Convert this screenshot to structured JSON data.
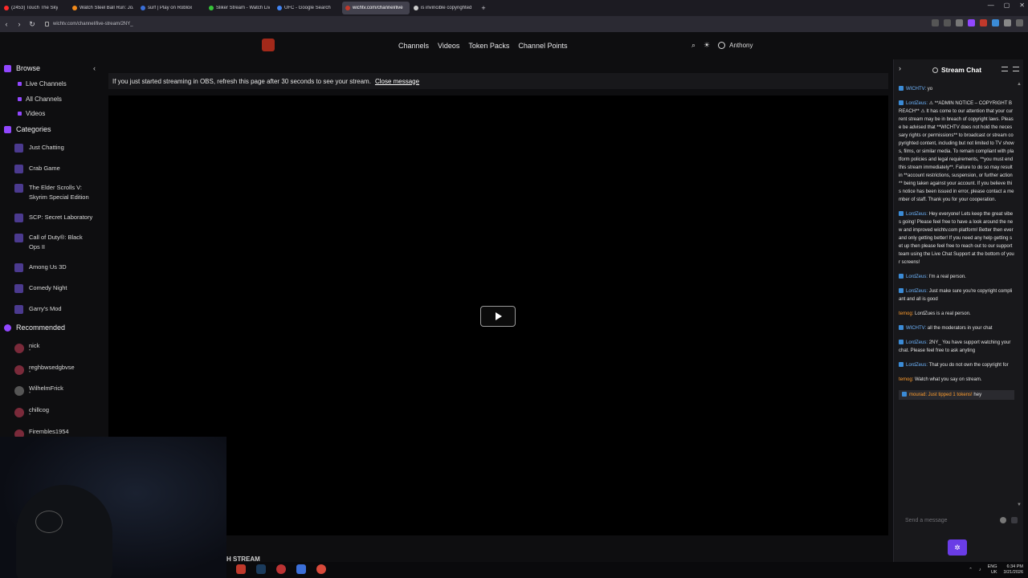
{
  "browser": {
    "tabs": [
      {
        "label": "(2453) Touch The Sky",
        "color": "#ff2a2a"
      },
      {
        "label": "Watch Steel Ball Run: JoJo",
        "color": "#f28a1a"
      },
      {
        "label": "surf | Play on Roblox",
        "color": "#3a6fd8"
      },
      {
        "label": "Sliker Stream - Watch Liv",
        "color": "#37c43a"
      },
      {
        "label": "UFC - Google Search",
        "color": "#4285f4"
      },
      {
        "label": "wichtv.com/channel/live",
        "color": "#c0392b"
      },
      {
        "label": "is invincible copyrighted",
        "color": "#cccccc"
      }
    ],
    "new_tab": "+",
    "url": "wichtv.com/channel/live-stream/2NY_"
  },
  "header": {
    "nav": [
      "Channels",
      "Videos",
      "Token Packs",
      "Channel Points"
    ],
    "user_name": "Anthony"
  },
  "sidebar": {
    "browse_title": "Browse",
    "browse_links": [
      "Live Channels",
      "All Channels",
      "Videos"
    ],
    "categories_title": "Categories",
    "categories": [
      "Just Chatting",
      "Crab Game",
      "The Elder Scrolls V: Skyrim Special Edition",
      "SCP: Secret Laboratory",
      "Call of Duty®: Black Ops II",
      "Among Us 3D",
      "Comedy Night",
      "Garry's Mod"
    ],
    "recommended_title": "Recommended",
    "recommended": [
      {
        "name": "nick",
        "sub": "•"
      },
      {
        "name": "reghbwsedgbvse",
        "sub": "•"
      },
      {
        "name": "WilhelmFrick",
        "sub": "•"
      },
      {
        "name": "chillcog",
        "sub": "•"
      },
      {
        "name": "Firembles1954",
        "sub": ""
      }
    ]
  },
  "main": {
    "notice_text": "If you just started streaming in OBS, refresh this page after 30 seconds to see your stream.",
    "close_message": "Close message",
    "below_player_text": "H STREAM"
  },
  "chat": {
    "title": "Stream Chat",
    "messages": [
      {
        "name": "WICHTV:",
        "text": "yo",
        "color": "blue"
      },
      {
        "name": "LordZeus:",
        "text": "⚠ **ADMIN NOTICE – COPYRIGHT BREACH** ⚠ It has come to our attention that your current stream may be in breach of copyright laws. Please be advised that **WICHTV does not hold the necessary rights or permissions** to broadcast or stream copyrighted content, including but not limited to TV shows, films, or similar media. To remain compliant with platform policies and legal requirements, **you must end this stream immediately**. Failure to do so may result in **account restrictions, suspension, or further action** being taken against your account. If you believe this notice has been issued in error, please contact a member of staff. Thank you for your cooperation.",
        "color": "blue"
      },
      {
        "name": "LordZeus:",
        "text": "Hey everyone! Lets keep the great vibes going! Please feel free to have a look around the new and improved wichtv.com platform! Better then ever and only getting better! If you need any help getting set up then please feel free to reach out to our support team using the Live Chat Support at the bottom of your screens!",
        "color": "blue"
      },
      {
        "name": "LordZeus:",
        "text": "I'm a real person.",
        "color": "blue"
      },
      {
        "name": "LordZeus:",
        "text": "Just make sure you're copyright compliant and all is good",
        "color": "blue"
      },
      {
        "name": "temog:",
        "text": "LordZues is a real person.",
        "color": "orange"
      },
      {
        "name": "WICHTV:",
        "text": "all the moderators in your chat",
        "color": "blue"
      },
      {
        "name": "LordZeus:",
        "text": "2NY_ You have support watching your chat. Please feel free to ask anyting",
        "color": "blue"
      },
      {
        "name": "LordZeus:",
        "text": "That you do not own the copyright for",
        "color": "blue"
      },
      {
        "name": "temog:",
        "text": "Watch what you say on stream.",
        "color": "orange"
      }
    ],
    "tip": {
      "name": "mourad: Just tipped 1 tokens!",
      "text": "hey"
    },
    "input_placeholder": "Send a message"
  },
  "taskbar": {
    "lang": "ENG",
    "region": "UK",
    "time": "6:34 PM",
    "date": "3/21/2026"
  },
  "colors": {
    "accent": "#9147ff",
    "chat_name": "#6fb6ff",
    "chat_name_alt": "#ff9d2e"
  }
}
